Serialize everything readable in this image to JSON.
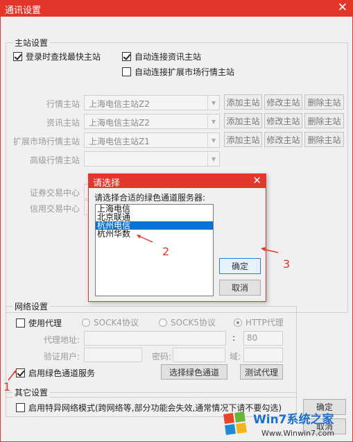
{
  "window": {
    "title": "通讯设置",
    "close_glyph": "✕"
  },
  "main_group": {
    "legend": "主站设置",
    "cb_find_fastest": "登录时查找最快主站",
    "cb_auto_info": "自动连接资讯主站",
    "cb_auto_ext": "自动连接扩展市场行情主站",
    "rows": [
      {
        "label": "行情主站",
        "value": "上海电信主站Z2"
      },
      {
        "label": "资讯主站",
        "value": "上海电信主站Z2"
      },
      {
        "label": "扩展市场行情主站",
        "value": "上海电信主站Z1"
      },
      {
        "label": "高级行情主站",
        "value": ""
      }
    ],
    "btn_add": "添加主站",
    "btn_edit": "修改主站",
    "btn_delete": "删除主站",
    "label_securities": "证券交易中心",
    "label_credit": "信用交易中心"
  },
  "network_group": {
    "legend": "网络设置",
    "cb_proxy": "使用代理",
    "radio_socks4": "SOCK4协议",
    "radio_socks5": "SOCK5协议",
    "radio_http": "HTTP代理",
    "label_proxy_addr": "代理地址:",
    "colon": ":",
    "port_value": "80",
    "label_auth_user": "验证用户:",
    "label_password": "密码:",
    "label_domain": "域:",
    "cb_green_channel": "启用绿色通道服务",
    "btn_select_green": "选择绿色通道",
    "btn_test_proxy": "测试代理"
  },
  "other_group": {
    "legend": "其它设置",
    "cb_special_network": "启用特异网络模式(跨网络等,部分功能会失效,通常情况下请不要勾选)"
  },
  "footer": {
    "btn_ok": "确定",
    "btn_cancel": "取消"
  },
  "dialog": {
    "title": "请选择",
    "close_glyph": "✕",
    "prompt": "请选择合适的绿色通道服务器:",
    "items": [
      "上海电信",
      "北京联通",
      "杭州电信",
      "杭州华数"
    ],
    "selected_index": 2,
    "btn_ok": "确定",
    "btn_cancel": "取消"
  },
  "annotations": [
    "1",
    "2",
    "3"
  ],
  "watermark": {
    "brand": "Win7系统之家",
    "url": "Www.Winwin7.com"
  },
  "colors": {
    "title_red": "#e3372c",
    "selection_blue": "#0a74d6"
  }
}
